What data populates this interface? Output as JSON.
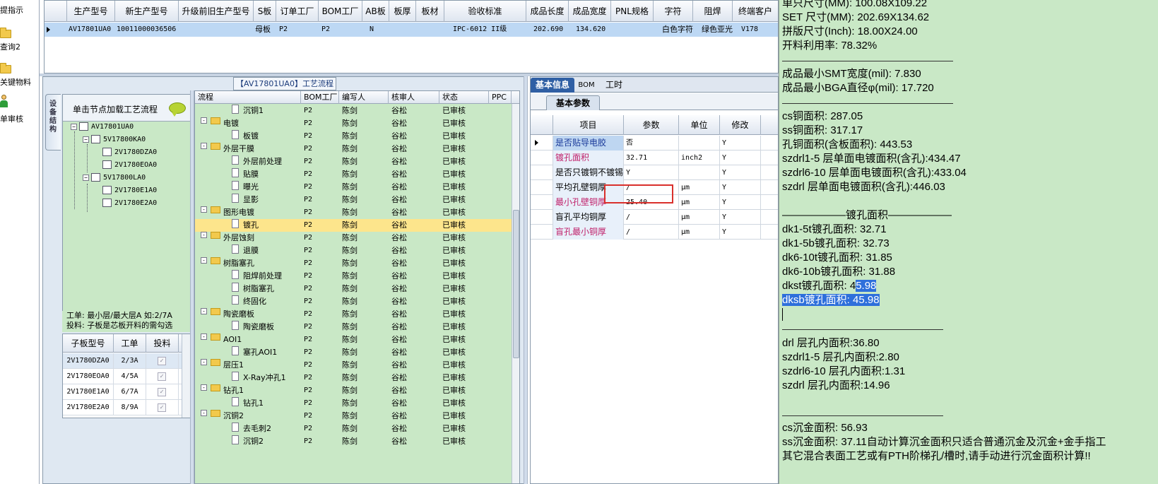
{
  "left_strip": {
    "items": [
      {
        "label": "提指示",
        "icon": "none"
      },
      {
        "label": "查询2",
        "icon": "folder-icon"
      },
      {
        "label": "关键物料",
        "icon": "folder-icon"
      },
      {
        "label": "单审核",
        "icon": "person-icon"
      }
    ]
  },
  "top_grid": {
    "columns": [
      "生产型号",
      "新生产型号",
      "升级前旧生产型号",
      "S板",
      "订单工厂",
      "BOM工厂",
      "AB板",
      "板厚",
      "板材",
      "验收标准",
      "成品长度",
      "成品宽度",
      "PNL规格",
      "字符",
      "阻焊",
      "终端客户"
    ],
    "row": [
      "AV17801UA0",
      "10011000036506",
      "",
      "母板",
      "P2",
      "P2",
      "N",
      "",
      "",
      "IPC-6012 II级",
      "202.690",
      "134.620",
      "",
      "白色字符",
      "绿色亚光",
      "V178"
    ]
  },
  "process_panel": {
    "title": "【AV17801UA0】工艺流程",
    "vertical_tab": "设备结构"
  },
  "tree": {
    "header": "单击节点加载工艺流程",
    "nodes": [
      {
        "label": "AV17801UA0",
        "level": 0,
        "expander": "-"
      },
      {
        "label": "5V17800KA0",
        "level": 1,
        "expander": "-"
      },
      {
        "label": "2V1780DZA0",
        "level": 2,
        "expander": ""
      },
      {
        "label": "2V1780EOA0",
        "level": 2,
        "expander": ""
      },
      {
        "label": "5V17800LA0",
        "level": 1,
        "expander": "-"
      },
      {
        "label": "2V1780E1A0",
        "level": 2,
        "expander": ""
      },
      {
        "label": "2V1780E2A0",
        "level": 2,
        "expander": ""
      }
    ]
  },
  "note": {
    "line1": "工单: 最小层/最大层A 如:2/7A",
    "line2": "投料: 子板是芯板开料的需勾选"
  },
  "sub_table": {
    "columns": [
      "子板型号",
      "工单",
      "投料"
    ],
    "rows": [
      {
        "model": "2V1780DZA0",
        "order": "2/3A",
        "checked": "✓"
      },
      {
        "model": "2V1780EOA0",
        "order": "4/5A",
        "checked": "✓"
      },
      {
        "model": "2V1780E1A0",
        "order": "6/7A",
        "checked": "✓"
      },
      {
        "model": "2V1780E2A0",
        "order": "8/9A",
        "checked": "✓"
      }
    ]
  },
  "process_list": {
    "columns": [
      "流程",
      "BOM工厂",
      "编写人",
      "核审人",
      "状态",
      "PPC"
    ],
    "rows": [
      {
        "type": "doc",
        "indent": 2,
        "name": "沉铜1",
        "bom": "P2",
        "writer": "陈剑",
        "reviewer": "谷松",
        "status": "已审核",
        "expander": ""
      },
      {
        "type": "folder",
        "indent": 1,
        "name": "电镀",
        "bom": "P2",
        "writer": "陈剑",
        "reviewer": "谷松",
        "status": "已审核",
        "expander": "-"
      },
      {
        "type": "doc",
        "indent": 2,
        "name": "板镀",
        "bom": "P2",
        "writer": "陈剑",
        "reviewer": "谷松",
        "status": "已审核",
        "expander": ""
      },
      {
        "type": "folder",
        "indent": 1,
        "name": "外层干膜",
        "bom": "P2",
        "writer": "陈剑",
        "reviewer": "谷松",
        "status": "已审核",
        "expander": "-"
      },
      {
        "type": "doc",
        "indent": 2,
        "name": "外层前处理",
        "bom": "P2",
        "writer": "陈剑",
        "reviewer": "谷松",
        "status": "已审核",
        "expander": ""
      },
      {
        "type": "doc",
        "indent": 2,
        "name": "贴膜",
        "bom": "P2",
        "writer": "陈剑",
        "reviewer": "谷松",
        "status": "已审核",
        "expander": ""
      },
      {
        "type": "doc",
        "indent": 2,
        "name": "曝光",
        "bom": "P2",
        "writer": "陈剑",
        "reviewer": "谷松",
        "status": "已审核",
        "expander": ""
      },
      {
        "type": "doc",
        "indent": 2,
        "name": "显影",
        "bom": "P2",
        "writer": "陈剑",
        "reviewer": "谷松",
        "status": "已审核",
        "expander": ""
      },
      {
        "type": "folder",
        "indent": 1,
        "name": "图形电镀",
        "bom": "P2",
        "writer": "陈剑",
        "reviewer": "谷松",
        "status": "已审核",
        "expander": "-"
      },
      {
        "type": "doc",
        "indent": 2,
        "name": "镀孔",
        "bom": "P2",
        "writer": "陈剑",
        "reviewer": "谷松",
        "status": "已审核",
        "expander": "",
        "selected": true
      },
      {
        "type": "folder",
        "indent": 1,
        "name": "外层蚀刻",
        "bom": "P2",
        "writer": "陈剑",
        "reviewer": "谷松",
        "status": "已审核",
        "expander": "-"
      },
      {
        "type": "doc",
        "indent": 2,
        "name": "退膜",
        "bom": "P2",
        "writer": "陈剑",
        "reviewer": "谷松",
        "status": "已审核",
        "expander": ""
      },
      {
        "type": "folder",
        "indent": 1,
        "name": "树脂塞孔",
        "bom": "P2",
        "writer": "陈剑",
        "reviewer": "谷松",
        "status": "已审核",
        "expander": "-"
      },
      {
        "type": "doc",
        "indent": 2,
        "name": "阻焊前处理",
        "bom": "P2",
        "writer": "陈剑",
        "reviewer": "谷松",
        "status": "已审核",
        "expander": ""
      },
      {
        "type": "doc",
        "indent": 2,
        "name": "树脂塞孔",
        "bom": "P2",
        "writer": "陈剑",
        "reviewer": "谷松",
        "status": "已审核",
        "expander": ""
      },
      {
        "type": "doc",
        "indent": 2,
        "name": "终固化",
        "bom": "P2",
        "writer": "陈剑",
        "reviewer": "谷松",
        "status": "已审核",
        "expander": ""
      },
      {
        "type": "folder",
        "indent": 1,
        "name": "陶瓷磨板",
        "bom": "P2",
        "writer": "陈剑",
        "reviewer": "谷松",
        "status": "已审核",
        "expander": "-"
      },
      {
        "type": "doc",
        "indent": 2,
        "name": "陶瓷磨板",
        "bom": "P2",
        "writer": "陈剑",
        "reviewer": "谷松",
        "status": "已审核",
        "expander": ""
      },
      {
        "type": "folder",
        "indent": 1,
        "name": "AOI1",
        "bom": "P2",
        "writer": "陈剑",
        "reviewer": "谷松",
        "status": "已审核",
        "expander": "-"
      },
      {
        "type": "doc",
        "indent": 2,
        "name": "塞孔AOI1",
        "bom": "P2",
        "writer": "陈剑",
        "reviewer": "谷松",
        "status": "已审核",
        "expander": ""
      },
      {
        "type": "folder",
        "indent": 1,
        "name": "层压1",
        "bom": "P2",
        "writer": "陈剑",
        "reviewer": "谷松",
        "status": "已审核",
        "expander": "-"
      },
      {
        "type": "doc",
        "indent": 2,
        "name": "X-Ray冲孔1",
        "bom": "P2",
        "writer": "陈剑",
        "reviewer": "谷松",
        "status": "已审核",
        "expander": ""
      },
      {
        "type": "folder",
        "indent": 1,
        "name": "钻孔1",
        "bom": "P2",
        "writer": "陈剑",
        "reviewer": "谷松",
        "status": "已审核",
        "expander": "-"
      },
      {
        "type": "doc",
        "indent": 2,
        "name": "钻孔1",
        "bom": "P2",
        "writer": "陈剑",
        "reviewer": "谷松",
        "status": "已审核",
        "expander": ""
      },
      {
        "type": "folder",
        "indent": 1,
        "name": "沉铜2",
        "bom": "P2",
        "writer": "陈剑",
        "reviewer": "谷松",
        "status": "已审核",
        "expander": "-"
      },
      {
        "type": "doc",
        "indent": 2,
        "name": "去毛刺2",
        "bom": "P2",
        "writer": "陈剑",
        "reviewer": "谷松",
        "status": "已审核",
        "expander": ""
      },
      {
        "type": "doc",
        "indent": 2,
        "name": "沉铜2",
        "bom": "P2",
        "writer": "陈剑",
        "reviewer": "谷松",
        "status": "已审核",
        "expander": ""
      }
    ]
  },
  "detail_panel": {
    "tabs": [
      "基本信息",
      "BOM",
      "工时"
    ],
    "subtab": "基本参数",
    "columns": [
      "项目",
      "参数",
      "单位",
      "修改"
    ],
    "rows": [
      {
        "item": "是否贴导电胶",
        "value": "否",
        "unit": "",
        "edit": "Y",
        "red": false,
        "sel": true
      },
      {
        "item": "镀孔面积",
        "value": "32.71",
        "unit": "inch2",
        "edit": "Y",
        "red": true,
        "sel": false
      },
      {
        "item": "是否只镀铜不镀锡",
        "value": "Y",
        "unit": "",
        "edit": "Y",
        "red": false,
        "sel": false
      },
      {
        "item": "平均孔壁铜厚",
        "value": "/",
        "unit": "μm",
        "edit": "Y",
        "red": false,
        "sel": false
      },
      {
        "item": "最小孔壁铜厚",
        "value": "25.40",
        "unit": "μm",
        "edit": "Y",
        "red": true,
        "sel": false
      },
      {
        "item": "盲孔平均铜厚",
        "value": "/",
        "unit": "μm",
        "edit": "Y",
        "red": false,
        "sel": false
      },
      {
        "item": "盲孔最小铜厚",
        "value": "/",
        "unit": "μm",
        "edit": "Y",
        "red": true,
        "sel": false
      }
    ]
  },
  "notes": {
    "lines": [
      {
        "text": "单只尺寸(MM): 100.08X109.22"
      },
      {
        "text": "SET 尺寸(MM): 202.69X134.62"
      },
      {
        "text": "拼版尺寸(Inch): 18.00X24.00"
      },
      {
        "text": "开料利用率: 78.32%"
      },
      {
        "text": "成品最小SMT宽度(mil): 7.830"
      },
      {
        "text": "成品最小BGA直径φ(mil):  17.720"
      },
      {
        "text": "cs铜面积: 287.05"
      },
      {
        "text": "ss铜面积: 317.17"
      },
      {
        "text": "孔铜面积(含板面积): 443.53"
      },
      {
        "text": "szdrl1-5      层单面电镀面积(含孔):434.47"
      },
      {
        "text": "szdrl6-10     层单面电镀面积(含孔):433.04"
      },
      {
        "text": "szdrl          层单面电镀面积(含孔):446.03"
      },
      {
        "text": "——————镀孔面积——————"
      },
      {
        "text": "dk1-5t镀孔面积: 32.71"
      },
      {
        "text": "dk1-5b镀孔面积: 32.73"
      },
      {
        "text": "dk6-10t镀孔面积: 31.85"
      },
      {
        "text": "dk6-10b镀孔面积: 31.88"
      },
      {
        "text": "dkst镀孔面积: 45.98",
        "hl_from": 11
      },
      {
        "text": "dksb镀孔面积: 45.98",
        "hl_from": 0
      },
      {
        "text": "drl           层孔内面积:36.80"
      },
      {
        "text": "szdrl1-5      层孔内面积:2.80"
      },
      {
        "text": "szdrl6-10     层孔内面积:1.31"
      },
      {
        "text": "szdrl          层孔内面积:14.96"
      },
      {
        "text": "cs沉金面积: 56.93"
      },
      {
        "text": "ss沉金面积: 37.11自动计算沉金面积只适合普通沉金及沉金+金手指工"
      },
      {
        "text": "其它混合表面工艺或有PTH阶梯孔/槽时,请手动进行沉金面积计算!!"
      }
    ]
  }
}
